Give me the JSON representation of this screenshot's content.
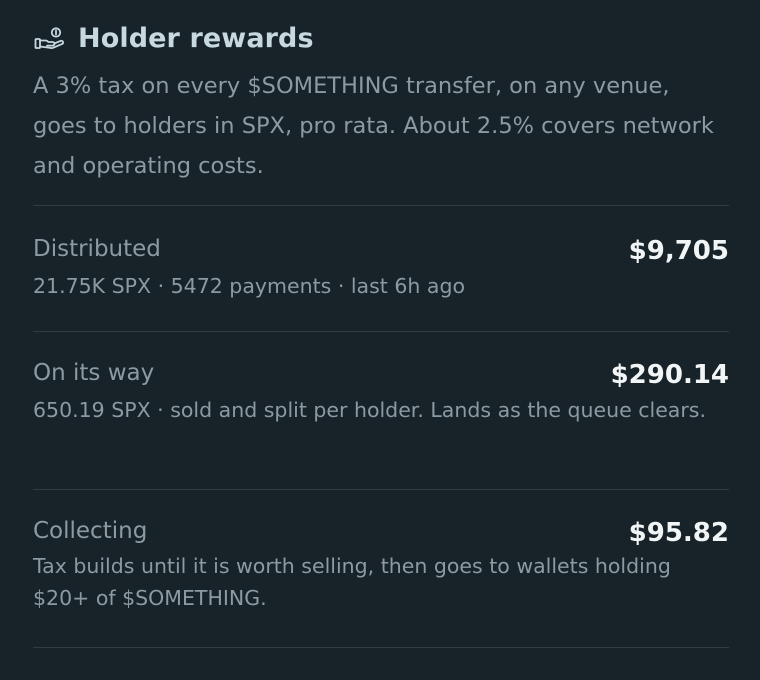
{
  "header": {
    "icon": "hand-coins-icon",
    "title": "Holder rewards"
  },
  "description": "A 3% tax on every $SOMETHING transfer, on any venue, goes to holders in SPX, pro rata. About 2.5% covers network and operating costs.",
  "stats": [
    {
      "label": "Distributed",
      "value": "$9,705",
      "detail": "21.75K SPX · 5472 payments · last 6h ago"
    },
    {
      "label": "On its way",
      "value": "$290.14",
      "detail": "650.19 SPX · sold and split per holder. Lands as the queue clears."
    },
    {
      "label": "Collecting",
      "value": "$95.82",
      "detail": "Tax builds until it is worth selling, then goes to wallets holding $20+ of $SOMETHING."
    }
  ],
  "colors": {
    "background": "#172329",
    "title": "#c7d8de",
    "muted_text": "#8c9ba1",
    "value_text": "#f2f5f6",
    "divider": "#2f3d43"
  }
}
